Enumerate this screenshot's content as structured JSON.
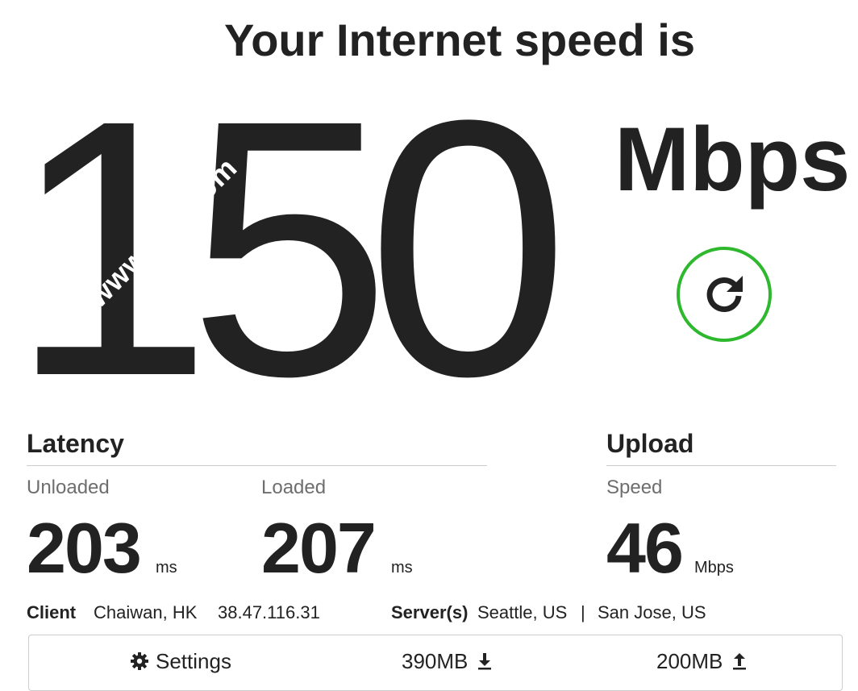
{
  "headline": "Your Internet speed is",
  "speed": {
    "value": "150",
    "unit": "Mbps"
  },
  "watermark": "www.****.com",
  "refresh": {
    "icon": "refresh-icon",
    "color": "#2eb82e"
  },
  "latency": {
    "title": "Latency",
    "unloaded": {
      "label": "Unloaded",
      "value": "203",
      "unit": "ms"
    },
    "loaded": {
      "label": "Loaded",
      "value": "207",
      "unit": "ms"
    }
  },
  "upload": {
    "title": "Upload",
    "speed": {
      "label": "Speed",
      "value": "46",
      "unit": "Mbps"
    }
  },
  "client": {
    "label": "Client",
    "location": "Chaiwan, HK",
    "ip": "38.47.116.31"
  },
  "servers": {
    "label": "Server(s)",
    "primary": "Seattle, US",
    "separator": "|",
    "secondary": "San Jose, US"
  },
  "settings_bar": {
    "settings_label": "Settings",
    "settings_icon": "gear-icon",
    "download_size": "390MB",
    "download_icon": "download-icon",
    "upload_size": "200MB",
    "upload_icon": "upload-icon"
  }
}
